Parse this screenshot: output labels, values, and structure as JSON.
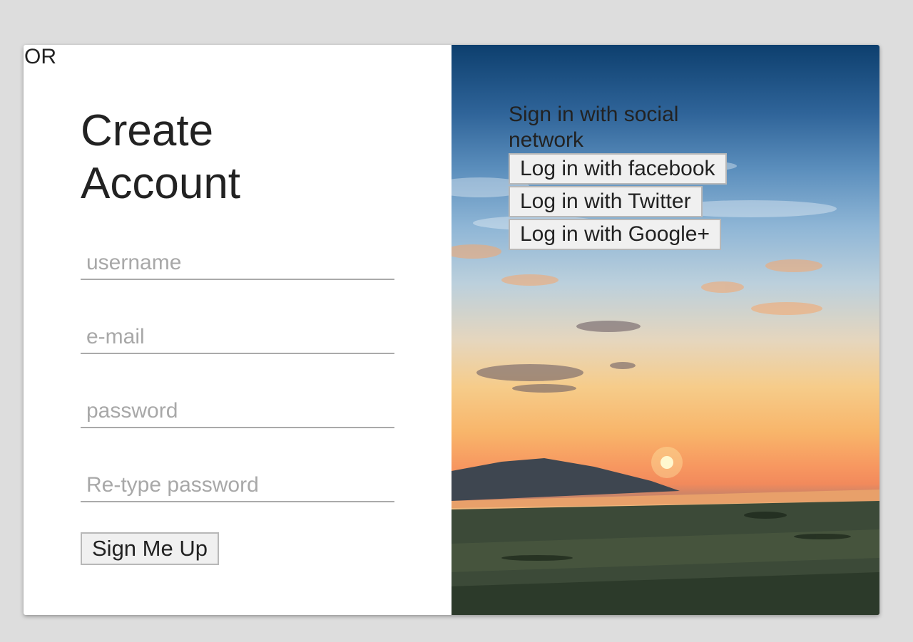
{
  "or_label": "OR",
  "create_account": {
    "title": "Create Account",
    "fields": [
      {
        "placeholder": "username",
        "value": ""
      },
      {
        "placeholder": "e-mail",
        "value": ""
      },
      {
        "placeholder": "password",
        "value": ""
      },
      {
        "placeholder": "Re-type password",
        "value": ""
      }
    ],
    "submit_label": "Sign Me Up"
  },
  "social": {
    "title": "Sign in with social network",
    "buttons": [
      {
        "label": "Log in with facebook"
      },
      {
        "label": "Log in with Twitter"
      },
      {
        "label": "Log in with Google+"
      }
    ]
  },
  "colors": {
    "background": "#dddddd",
    "card": "#ffffff",
    "field_underline": "#aaaaaa",
    "placeholder": "#a8a8a8",
    "button_bg": "#f0f0f0",
    "button_border": "#b8b8b8"
  },
  "background_image": "sunset-landscape-photo"
}
